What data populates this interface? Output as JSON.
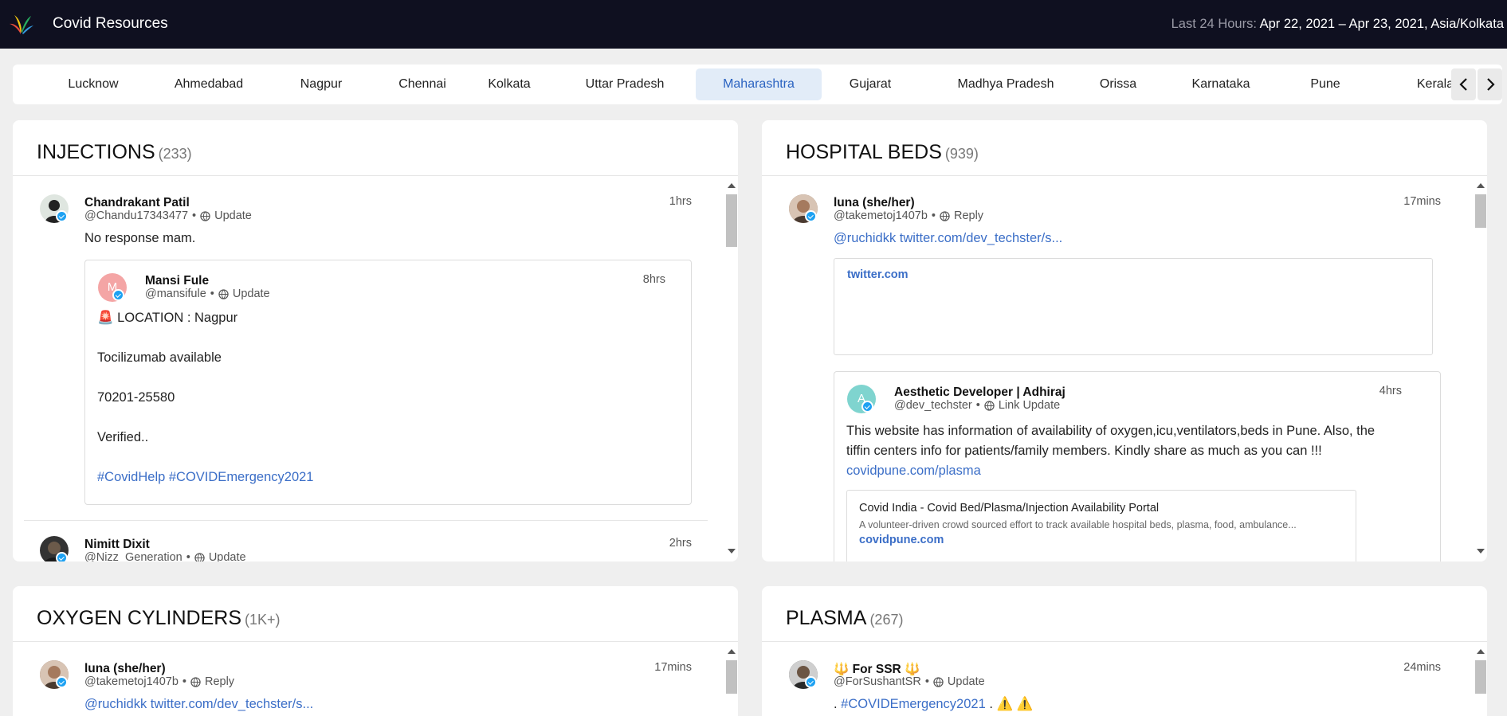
{
  "header": {
    "app_title": "Covid Resources",
    "range_label": "Last 24 Hours:",
    "range_value": "Apr 22, 2021 – Apr 23, 2021, Asia/Kolkata"
  },
  "tabs": [
    {
      "label": "Lucknow"
    },
    {
      "label": "Ahmedabad"
    },
    {
      "label": "Nagpur"
    },
    {
      "label": "Chennai"
    },
    {
      "label": "Kolkata"
    },
    {
      "label": "Uttar Pradesh"
    },
    {
      "label": "Maharashtra",
      "active": true
    },
    {
      "label": "Gujarat"
    },
    {
      "label": "Madhya Pradesh"
    },
    {
      "label": "Orissa"
    },
    {
      "label": "Karnataka"
    },
    {
      "label": "Pune"
    },
    {
      "label": "Kerala"
    }
  ],
  "panels": {
    "injections": {
      "title": "INJECTIONS",
      "count": "(233)",
      "posts": [
        {
          "name": "Chandrakant Patil",
          "handle": "@Chandu17343477",
          "action": "Update",
          "time": "1hrs",
          "text": "No response mam.",
          "quote": {
            "initial": "M",
            "name": "Mansi Fule",
            "handle": "@mansifule",
            "action": "Update",
            "time": "8hrs",
            "lines": [
              "🚨 LOCATION : Nagpur",
              "Tocilizumab available",
              "70201-25580",
              "Verified..",
              "#CovidHelp #COVIDEmergency2021"
            ]
          }
        },
        {
          "name": "Nimitt Dixit",
          "handle": "@Nizz_Generation",
          "action": "Update",
          "time": "2hrs"
        }
      ]
    },
    "hospital_beds": {
      "title": "HOSPITAL BEDS",
      "count": "(939)",
      "posts": [
        {
          "name": "luna (she/her)",
          "handle": "@takemetoj1407b",
          "action": "Reply",
          "time": "17mins",
          "link_text": "@ruchidkk twitter.com/dev_techster/s...",
          "card_domain": "twitter.com",
          "quote": {
            "initial": "A",
            "name": "Aesthetic Developer | Adhiraj",
            "handle": "@dev_techster",
            "action": "Link Update",
            "time": "4hrs",
            "text_line1": "This website has information of availability of oxygen,icu,ventilators,beds in Pune. Also, the",
            "text_line2": "tiffin centers info for patients/family members. Kindly share as much as you can !!!",
            "link": "covidpune.com/plasma",
            "card_title": "Covid India - Covid Bed/Plasma/Injection Availability Portal",
            "card_desc": "A volunteer-driven crowd sourced effort to track available hospital beds, plasma, food, ambulance...",
            "card_domain": "covidpune.com"
          }
        }
      ]
    },
    "oxygen": {
      "title": "OXYGEN CYLINDERS",
      "count": "(1K+)",
      "posts": [
        {
          "name": "luna (she/her)",
          "handle": "@takemetoj1407b",
          "action": "Reply",
          "time": "17mins",
          "link_text": "@ruchidkk twitter.com/dev_techster/s..."
        }
      ]
    },
    "plasma": {
      "title": "PLASMA",
      "count": "(267)",
      "posts": [
        {
          "name": "🔱 For SSR 🔱",
          "handle": "@ForSushantSR",
          "action": "Update",
          "time": "24mins",
          "text_prefix": ". ",
          "hashtag": "#COVIDEmergency2021",
          "text_suffix": " . ⚠️ ⚠️"
        }
      ]
    }
  }
}
